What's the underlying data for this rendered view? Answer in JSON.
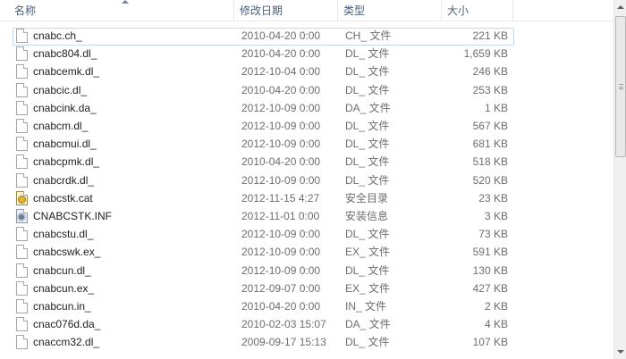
{
  "columns": {
    "name": "名称",
    "date": "修改日期",
    "type": "类型",
    "size": "大小"
  },
  "sort": {
    "column": "name",
    "direction": "ascending"
  },
  "files": [
    {
      "name": "cnabc.ch_",
      "date": "2010-04-20 0:00",
      "type": "CH_ 文件",
      "size": "221 KB",
      "icon": "file-icon"
    },
    {
      "name": "cnabc804.dl_",
      "date": "2010-04-20 0:00",
      "type": "DL_ 文件",
      "size": "1,659 KB",
      "icon": "file-icon"
    },
    {
      "name": "cnabcemk.dl_",
      "date": "2012-10-04 0:00",
      "type": "DL_ 文件",
      "size": "246 KB",
      "icon": "file-icon"
    },
    {
      "name": "cnabcic.dl_",
      "date": "2010-04-20 0:00",
      "type": "DL_ 文件",
      "size": "253 KB",
      "icon": "file-icon"
    },
    {
      "name": "cnabcink.da_",
      "date": "2012-10-09 0:00",
      "type": "DA_ 文件",
      "size": "1 KB",
      "icon": "file-icon"
    },
    {
      "name": "cnabcm.dl_",
      "date": "2012-10-09 0:00",
      "type": "DL_ 文件",
      "size": "567 KB",
      "icon": "file-icon"
    },
    {
      "name": "cnabcmui.dl_",
      "date": "2012-10-09 0:00",
      "type": "DL_ 文件",
      "size": "681 KB",
      "icon": "file-icon"
    },
    {
      "name": "cnabcpmk.dl_",
      "date": "2010-04-20 0:00",
      "type": "DL_ 文件",
      "size": "518 KB",
      "icon": "file-icon"
    },
    {
      "name": "cnabcrdk.dl_",
      "date": "2012-10-09 0:00",
      "type": "DL_ 文件",
      "size": "520 KB",
      "icon": "file-icon"
    },
    {
      "name": "cnabcstk.cat",
      "date": "2012-11-15 4:27",
      "type": "安全目录",
      "size": "23 KB",
      "icon": "security-catalog-icon"
    },
    {
      "name": "CNABCSTK.INF",
      "date": "2012-11-01 0:00",
      "type": "安装信息",
      "size": "3 KB",
      "icon": "setup-information-icon"
    },
    {
      "name": "cnabcstu.dl_",
      "date": "2012-10-09 0:00",
      "type": "DL_ 文件",
      "size": "73 KB",
      "icon": "file-icon"
    },
    {
      "name": "cnabcswk.ex_",
      "date": "2012-10-09 0:00",
      "type": "EX_ 文件",
      "size": "591 KB",
      "icon": "file-icon"
    },
    {
      "name": "cnabcun.dl_",
      "date": "2012-10-09 0:00",
      "type": "DL_ 文件",
      "size": "130 KB",
      "icon": "file-icon"
    },
    {
      "name": "cnabcun.ex_",
      "date": "2012-09-07 0:00",
      "type": "EX_ 文件",
      "size": "427 KB",
      "icon": "file-icon"
    },
    {
      "name": "cnabcun.in_",
      "date": "2010-04-20 0:00",
      "type": "IN_ 文件",
      "size": "2 KB",
      "icon": "file-icon"
    },
    {
      "name": "cnac076d.da_",
      "date": "2010-02-03 15:07",
      "type": "DA_ 文件",
      "size": "4 KB",
      "icon": "file-icon"
    },
    {
      "name": "cnaccm32.dl_",
      "date": "2009-09-17 15:13",
      "type": "DL_ 文件",
      "size": "107 KB",
      "icon": "file-icon"
    }
  ],
  "focused_row": 0,
  "colors": {
    "header_text": "#4c607a",
    "focus_border": "#c4d7ee",
    "secondary_text": "#6d6d6d"
  }
}
